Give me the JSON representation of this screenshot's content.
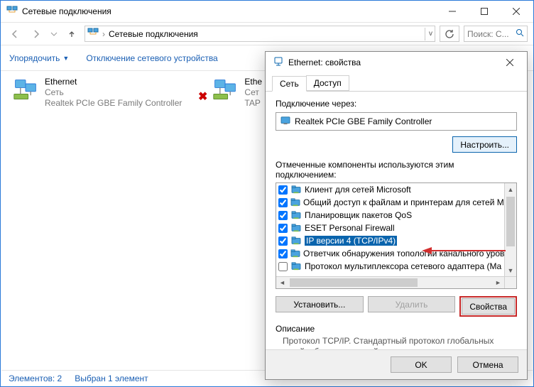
{
  "window": {
    "title": "Сетевые подключения",
    "breadcrumb": "Сетевые подключения",
    "search_placeholder": "Поиск: С..."
  },
  "cmdbar": {
    "organize": "Упорядочить",
    "disable": "Отключение сетевого устройства"
  },
  "items": [
    {
      "name": "Ethernet",
      "status": "Сеть",
      "device": "Realtek PCIe GBE Family Controller"
    },
    {
      "name": "Ethe",
      "status": "Сет",
      "device": "TAP"
    }
  ],
  "statusbar": {
    "elements": "Элементов: 2",
    "selected": "Выбран 1 элемент"
  },
  "dialog": {
    "title": "Ethernet: свойства",
    "tabs": {
      "net": "Сеть",
      "access": "Доступ"
    },
    "conn_via_label": "Подключение через:",
    "adapter": "Realtek PCIe GBE Family Controller",
    "configure_btn": "Настроить...",
    "components_label": "Отмеченные компоненты используются этим подключением:",
    "components": [
      {
        "label": "Клиент для сетей Microsoft",
        "checked": true
      },
      {
        "label": "Общий доступ к файлам и принтерам для сетей Mi",
        "checked": true
      },
      {
        "label": "Планировщик пакетов QoS",
        "checked": true
      },
      {
        "label": "ESET Personal Firewall",
        "checked": true
      },
      {
        "label": "IP версии 4 (TCP/IPv4)",
        "checked": true,
        "selected": true
      },
      {
        "label": "Ответчик обнаружения топологии канального уров",
        "checked": true
      },
      {
        "label": "Протокол мультиплексора сетевого адаптера (Ma",
        "checked": false
      }
    ],
    "install_btn": "Установить...",
    "uninstall_btn": "Удалить",
    "properties_btn": "Свойства",
    "desc_title": "Описание",
    "desc_text": "Протокол TCP/IP. Стандартный протокол глобальных сетей, обеспечивающий связь между различными взаимодействующими сетями.",
    "ok": "OK",
    "cancel": "Отмена"
  }
}
